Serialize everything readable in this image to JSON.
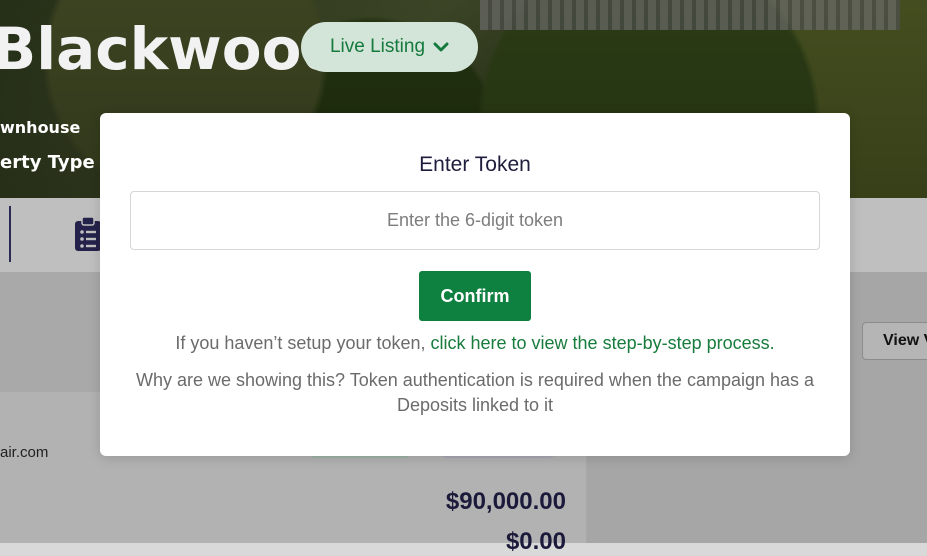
{
  "hero": {
    "title": "Blackwood",
    "status_pill": "Live Listing",
    "property_subtype": "wnhouse",
    "property_type_label": "erty Type"
  },
  "background": {
    "email_fragment": "air.com",
    "view_button": "View V",
    "amount_primary": "$90,000.00",
    "amount_secondary": "$0.00"
  },
  "modal": {
    "title": "Enter Token",
    "token_input": {
      "placeholder": "Enter the 6-digit token",
      "value": ""
    },
    "confirm_label": "Confirm",
    "help_prefix": "If you haven’t setup your token, ",
    "help_link": "click here to view the step-by-step process.",
    "why_text": "Why are we showing this? Token authentication is required when the campaign has a Deposits linked to it"
  },
  "colors": {
    "brand_green": "#0e8040",
    "link_green": "#177c3c",
    "pill_bg": "#d3e4d8",
    "heading_navy": "#1f1d3d"
  }
}
